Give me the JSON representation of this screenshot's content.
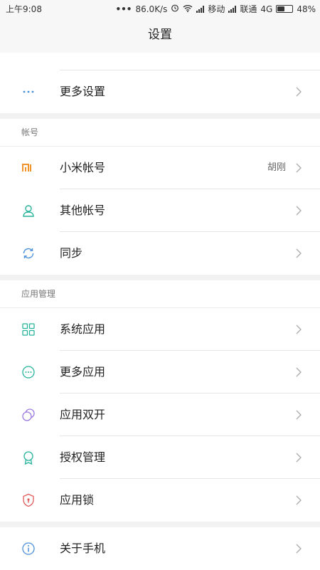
{
  "status_bar": {
    "time": "上午9:08",
    "net_speed": "86.0K/s",
    "carrier1": "移动",
    "carrier2": "联通",
    "net_type": "4G",
    "battery": "48%",
    "battery_level": 0.48
  },
  "title": "设置",
  "groups": [
    {
      "items": [
        {
          "label": "更多设置",
          "icon": "more-dots-icon",
          "color": "#4a90d9"
        }
      ]
    },
    {
      "header": "帐号",
      "items": [
        {
          "label": "小米帐号",
          "value": "胡刚",
          "icon": "mi-logo-icon",
          "color": "#f0932b"
        },
        {
          "label": "其他帐号",
          "icon": "person-icon",
          "color": "#26b39a"
        },
        {
          "label": "同步",
          "icon": "sync-icon",
          "color": "#4a90d9"
        }
      ]
    },
    {
      "header": "应用管理",
      "items": [
        {
          "label": "系统应用",
          "icon": "grid-icon",
          "color": "#26b39a"
        },
        {
          "label": "更多应用",
          "icon": "more-circle-icon",
          "color": "#26b39a"
        },
        {
          "label": "应用双开",
          "icon": "dual-circle-icon",
          "color": "#9b7be0"
        },
        {
          "label": "授权管理",
          "icon": "badge-icon",
          "color": "#26b39a"
        },
        {
          "label": "应用锁",
          "icon": "shield-lock-icon",
          "color": "#e05a5a"
        }
      ]
    },
    {
      "items": [
        {
          "label": "关于手机",
          "icon": "info-icon",
          "color": "#4a90d9"
        }
      ]
    }
  ]
}
